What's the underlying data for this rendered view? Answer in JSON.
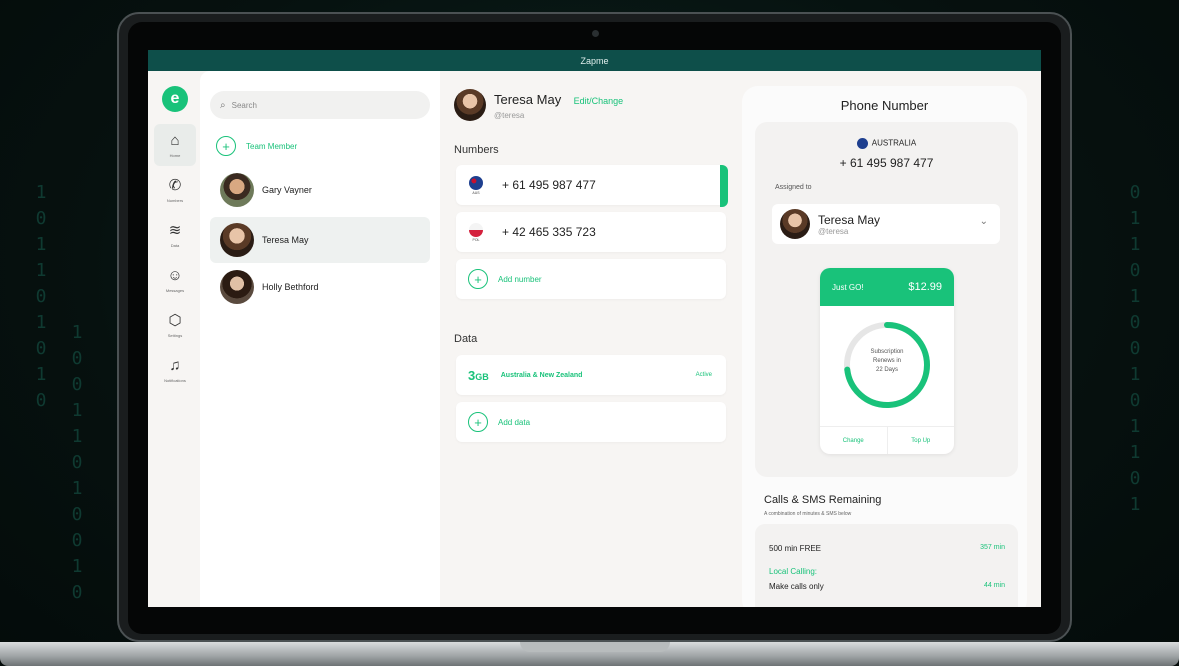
{
  "window": {
    "title": "Zapme"
  },
  "nav": {
    "logo": "e",
    "items": [
      {
        "label": "Home",
        "icon": "home-icon",
        "glyph": "⌂"
      },
      {
        "label": "Numbers",
        "icon": "phone-icon",
        "glyph": "✆"
      },
      {
        "label": "Data",
        "icon": "wifi-icon",
        "glyph": "≋"
      },
      {
        "label": "Messages",
        "icon": "message-icon",
        "glyph": "☺"
      },
      {
        "label": "Settings",
        "icon": "settings-icon",
        "glyph": "⬡"
      },
      {
        "label": "Notifications",
        "icon": "bell-icon",
        "glyph": "♫"
      }
    ]
  },
  "members": {
    "search_placeholder": "Search",
    "add_label": "Team Member",
    "list": [
      {
        "name": "Gary Vayner"
      },
      {
        "name": "Teresa May"
      },
      {
        "name": "Holly Bethford"
      }
    ]
  },
  "details": {
    "name": "Teresa May",
    "edit_label": "Edit/Change",
    "handle": "@teresa",
    "numbers_title": "Numbers",
    "numbers": [
      {
        "code": "AUS",
        "number": "+ 61 495 987 477"
      },
      {
        "code": "POL",
        "number": "+ 42 465 335 723"
      }
    ],
    "add_number_label": "Add number",
    "data_title": "Data",
    "data_plan": {
      "amount": "3",
      "unit": "GB",
      "region": "Australia & New Zealand",
      "status": "Active"
    },
    "add_data_label": "Add data"
  },
  "phone_panel": {
    "title": "Phone Number",
    "country": "AUSTRALIA",
    "number": "+ 61 495 987 477",
    "assigned_label": "Assigned to",
    "assigned_name": "Teresa May",
    "assigned_handle": "@teresa",
    "plan": {
      "name": "Just GO!",
      "price": "$12.99",
      "ring_line1": "Subscription",
      "ring_line2": "Renews in",
      "ring_line3": "22 Days",
      "progress": 0.73,
      "change_label": "Change",
      "topup_label": "Top Up"
    },
    "calls_title": "Calls & SMS Remaining",
    "calls_sub": "A combination of minutes & SMS below",
    "calls": {
      "plan_label": "500 min FREE",
      "plan_value": "357 min",
      "local_label": "Local Calling:",
      "make_label": "Make calls only",
      "make_value": "44 min"
    }
  },
  "colors": {
    "accent": "#19c27a",
    "titlebar": "#0e4f4a"
  }
}
